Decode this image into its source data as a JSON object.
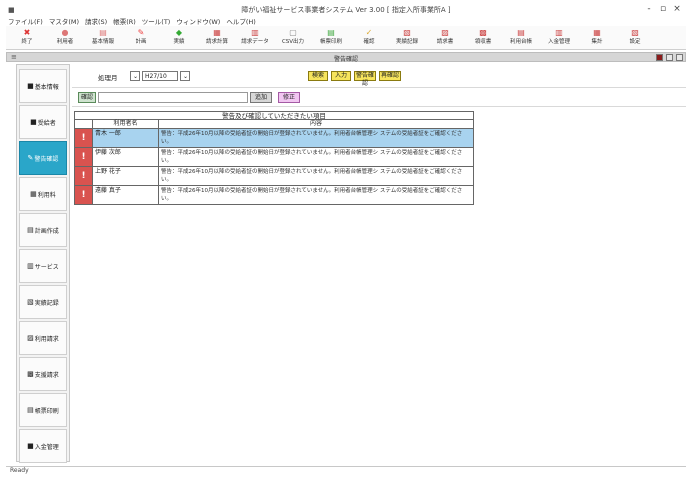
{
  "window": {
    "title": "障がい福祉サービス事業者システム Ver 3.00 [ 指定入所事業所A ]",
    "controls": [
      "-",
      "▫",
      "×"
    ]
  },
  "menu": [
    "ファイル(F)",
    "マスタ(M)",
    "請求(S)",
    "帳票(R)",
    "ツール(T)",
    "ウィンドウ(W)",
    "ヘルプ(H)"
  ],
  "toolbar": [
    {
      "icon": "exit-icon",
      "label": "終了"
    },
    {
      "icon": "user-icon",
      "label": "利用者"
    },
    {
      "icon": "list-icon",
      "label": "基本情報"
    },
    {
      "icon": "plan-icon",
      "label": "計画"
    },
    {
      "icon": "record-icon",
      "label": "実績"
    },
    {
      "icon": "calc-icon",
      "label": "請求計算"
    },
    {
      "icon": "data-icon",
      "label": "請求データ"
    },
    {
      "icon": "output-icon",
      "label": "CSV出力"
    },
    {
      "icon": "print-icon",
      "label": "帳票印刷"
    },
    {
      "icon": "check-icon",
      "label": "確認"
    },
    {
      "icon": "report-icon",
      "label": "実績記録"
    },
    {
      "icon": "invoice-icon",
      "label": "請求書"
    },
    {
      "icon": "receipt-icon",
      "label": "領収書"
    },
    {
      "icon": "book-icon",
      "label": "利用台帳"
    },
    {
      "icon": "pay-icon",
      "label": "入金管理"
    },
    {
      "icon": "chart-icon",
      "label": "集計"
    },
    {
      "icon": "more-icon",
      "label": "設定"
    }
  ],
  "panel": {
    "title": "警告確認"
  },
  "sidebar": [
    {
      "icon": "home-icon",
      "label": "基本情報"
    },
    {
      "icon": "card-icon",
      "label": "受給者"
    },
    {
      "icon": "check-icon",
      "label": "警告確認",
      "active": true
    },
    {
      "icon": "calc-icon",
      "label": "利用料"
    },
    {
      "icon": "doc-icon",
      "label": "計画作成"
    },
    {
      "icon": "service-icon",
      "label": "サービス"
    },
    {
      "icon": "record-icon",
      "label": "実績記録"
    },
    {
      "icon": "bill-icon",
      "label": "利用請求"
    },
    {
      "icon": "invoice-icon",
      "label": "支援請求"
    },
    {
      "icon": "print-icon",
      "label": "帳票印刷"
    },
    {
      "icon": "money-icon",
      "label": "入金管理"
    }
  ],
  "filter": {
    "label": "処理月",
    "month": "H27/10",
    "buttons": {
      "search": "検索",
      "input": "入力",
      "extra1": "警告確認",
      "extra2": "再確認"
    }
  },
  "row2": {
    "confirm_label": "確認",
    "edit_label": "追加",
    "delete_label": "修正"
  },
  "table": {
    "title": "警告及び確認していただきたい項目",
    "headers": [
      "利用者名",
      "内容"
    ],
    "rows": [
      {
        "name": "青木 一郎",
        "msg": "警告：平成26年10月以降の受給者証の開始日が登録されていません。利用者台帳管理シ ステムの受給者証をご確認ください。",
        "selected": true
      },
      {
        "name": "伊藤 次郎",
        "msg": "警告：平成26年10月以降の受給者証の開始日が登録されていません。利用者台帳管理シ ステムの受給者証をご確認ください。",
        "selected": false
      },
      {
        "name": "上野 花子",
        "msg": "警告：平成26年10月以降の受給者証の開始日が登録されていません。利用者台帳管理シ ステムの受給者証をご確認ください。",
        "selected": false
      },
      {
        "name": "遠藤 真子",
        "msg": "警告：平成26年10月以降の受給者証の開始日が登録されていません。利用者台帳管理シ ステムの受給者証をご確認ください。",
        "selected": false
      }
    ]
  },
  "status": {
    "text": "Ready"
  }
}
